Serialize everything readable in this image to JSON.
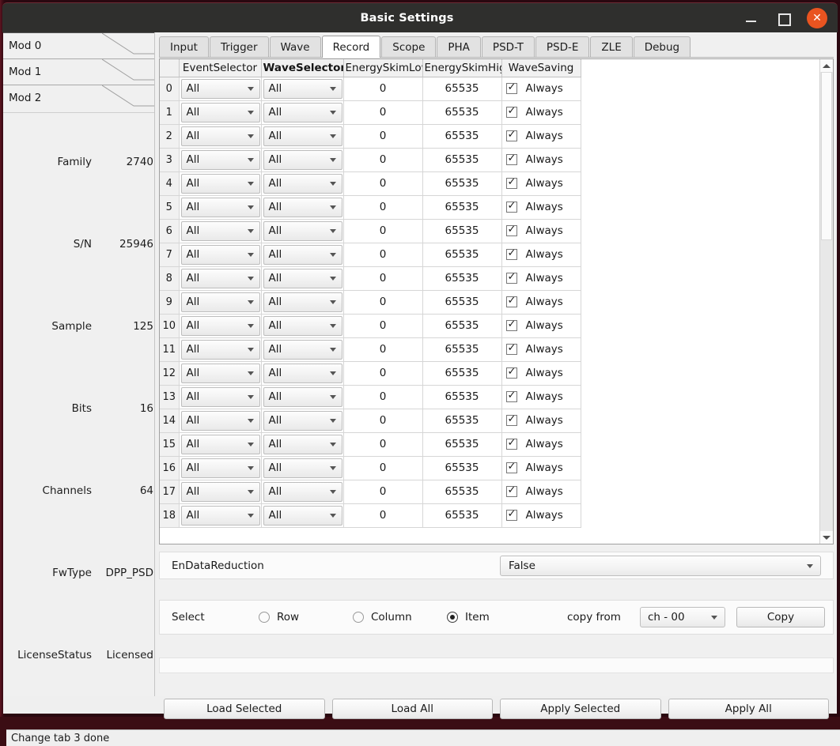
{
  "window": {
    "title": "Basic Settings",
    "minimize_label": "",
    "maximize_label": "",
    "close_label": "✕",
    "close_color": "#e95420"
  },
  "sidebar": {
    "mod_tabs": [
      {
        "label": "Mod 0"
      },
      {
        "label": "Mod 1"
      },
      {
        "label": "Mod 2"
      }
    ],
    "device_info": [
      {
        "label": "Family",
        "value": "2740"
      },
      {
        "label": "S/N",
        "value": "25946"
      },
      {
        "label": "Sample",
        "value": "125"
      },
      {
        "label": "Bits",
        "value": "16"
      },
      {
        "label": "Channels",
        "value": "64"
      },
      {
        "label": "FwType",
        "value": "DPP_PSD"
      },
      {
        "label": "LicenseStatus",
        "value": "Licensed"
      }
    ]
  },
  "tabs": [
    {
      "label": "Input",
      "active": false
    },
    {
      "label": "Trigger",
      "active": false
    },
    {
      "label": "Wave",
      "active": false
    },
    {
      "label": "Record",
      "active": true
    },
    {
      "label": "Scope",
      "active": false
    },
    {
      "label": "PHA",
      "active": false
    },
    {
      "label": "PSD-T",
      "active": false
    },
    {
      "label": "PSD-E",
      "active": false
    },
    {
      "label": "ZLE",
      "active": false
    },
    {
      "label": "Debug",
      "active": false
    }
  ],
  "table": {
    "headers": [
      {
        "label": "",
        "kind": "corner"
      },
      {
        "label": "EventSelector",
        "kind": "combo"
      },
      {
        "label": "WaveSelector",
        "kind": "combo",
        "bold": true
      },
      {
        "label": "EnergySkimLow",
        "kind": "num"
      },
      {
        "label": "EnergySkimHigh",
        "kind": "num"
      },
      {
        "label": "WaveSaving",
        "kind": "save"
      }
    ],
    "rows": [
      {
        "index": "0",
        "event_selector": "All",
        "wave_selector": "All",
        "energy_skim_low": "0",
        "energy_skim_high": "65535",
        "wave_saving_checked": true,
        "wave_saving": "Always"
      },
      {
        "index": "1",
        "event_selector": "All",
        "wave_selector": "All",
        "energy_skim_low": "0",
        "energy_skim_high": "65535",
        "wave_saving_checked": true,
        "wave_saving": "Always"
      },
      {
        "index": "2",
        "event_selector": "All",
        "wave_selector": "All",
        "energy_skim_low": "0",
        "energy_skim_high": "65535",
        "wave_saving_checked": true,
        "wave_saving": "Always"
      },
      {
        "index": "3",
        "event_selector": "All",
        "wave_selector": "All",
        "energy_skim_low": "0",
        "energy_skim_high": "65535",
        "wave_saving_checked": true,
        "wave_saving": "Always"
      },
      {
        "index": "4",
        "event_selector": "All",
        "wave_selector": "All",
        "energy_skim_low": "0",
        "energy_skim_high": "65535",
        "wave_saving_checked": true,
        "wave_saving": "Always"
      },
      {
        "index": "5",
        "event_selector": "All",
        "wave_selector": "All",
        "energy_skim_low": "0",
        "energy_skim_high": "65535",
        "wave_saving_checked": true,
        "wave_saving": "Always"
      },
      {
        "index": "6",
        "event_selector": "All",
        "wave_selector": "All",
        "energy_skim_low": "0",
        "energy_skim_high": "65535",
        "wave_saving_checked": true,
        "wave_saving": "Always"
      },
      {
        "index": "7",
        "event_selector": "All",
        "wave_selector": "All",
        "energy_skim_low": "0",
        "energy_skim_high": "65535",
        "wave_saving_checked": true,
        "wave_saving": "Always"
      },
      {
        "index": "8",
        "event_selector": "All",
        "wave_selector": "All",
        "energy_skim_low": "0",
        "energy_skim_high": "65535",
        "wave_saving_checked": true,
        "wave_saving": "Always"
      },
      {
        "index": "9",
        "event_selector": "All",
        "wave_selector": "All",
        "energy_skim_low": "0",
        "energy_skim_high": "65535",
        "wave_saving_checked": true,
        "wave_saving": "Always"
      },
      {
        "index": "10",
        "event_selector": "All",
        "wave_selector": "All",
        "energy_skim_low": "0",
        "energy_skim_high": "65535",
        "wave_saving_checked": true,
        "wave_saving": "Always"
      },
      {
        "index": "11",
        "event_selector": "All",
        "wave_selector": "All",
        "energy_skim_low": "0",
        "energy_skim_high": "65535",
        "wave_saving_checked": true,
        "wave_saving": "Always"
      },
      {
        "index": "12",
        "event_selector": "All",
        "wave_selector": "All",
        "energy_skim_low": "0",
        "energy_skim_high": "65535",
        "wave_saving_checked": true,
        "wave_saving": "Always"
      },
      {
        "index": "13",
        "event_selector": "All",
        "wave_selector": "All",
        "energy_skim_low": "0",
        "energy_skim_high": "65535",
        "wave_saving_checked": true,
        "wave_saving": "Always"
      },
      {
        "index": "14",
        "event_selector": "All",
        "wave_selector": "All",
        "energy_skim_low": "0",
        "energy_skim_high": "65535",
        "wave_saving_checked": true,
        "wave_saving": "Always"
      },
      {
        "index": "15",
        "event_selector": "All",
        "wave_selector": "All",
        "energy_skim_low": "0",
        "energy_skim_high": "65535",
        "wave_saving_checked": true,
        "wave_saving": "Always"
      },
      {
        "index": "16",
        "event_selector": "All",
        "wave_selector": "All",
        "energy_skim_low": "0",
        "energy_skim_high": "65535",
        "wave_saving_checked": true,
        "wave_saving": "Always"
      },
      {
        "index": "17",
        "event_selector": "All",
        "wave_selector": "All",
        "energy_skim_low": "0",
        "energy_skim_high": "65535",
        "wave_saving_checked": true,
        "wave_saving": "Always"
      },
      {
        "index": "18",
        "event_selector": "All",
        "wave_selector": "All",
        "energy_skim_low": "0",
        "energy_skim_high": "65535",
        "wave_saving_checked": true,
        "wave_saving": "Always"
      }
    ]
  },
  "reduction": {
    "label": "EnDataReduction",
    "value": "False"
  },
  "select_row": {
    "label": "Select",
    "options": [
      {
        "label": "Row",
        "selected": false
      },
      {
        "label": "Column",
        "selected": false
      },
      {
        "label": "Item",
        "selected": true
      }
    ],
    "copy_from_label": "copy from",
    "channel_value": "ch - 00",
    "copy_button": "Copy"
  },
  "bottom_buttons": [
    {
      "label": "Load Selected"
    },
    {
      "label": "Load All"
    },
    {
      "label": "Apply Selected"
    },
    {
      "label": "Apply All"
    }
  ],
  "status_bar": {
    "message": "Change tab 3 done"
  }
}
